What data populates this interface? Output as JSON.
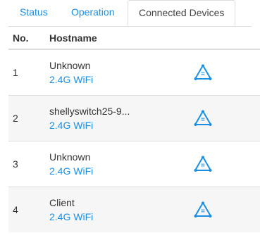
{
  "tabs": [
    {
      "label": "Status"
    },
    {
      "label": "Operation"
    },
    {
      "label": "Connected Devices",
      "active": true
    }
  ],
  "table": {
    "headers": {
      "no": "No.",
      "hostname": "Hostname"
    },
    "rows": [
      {
        "no": "1",
        "hostname": "Unknown",
        "band": "2.4G WiFi",
        "icon": "mesh-topology-icon"
      },
      {
        "no": "2",
        "hostname": "shellyswitch25-9...",
        "band": "2.4G WiFi",
        "icon": "mesh-topology-icon"
      },
      {
        "no": "3",
        "hostname": "Unknown",
        "band": "2.4G WiFi",
        "icon": "mesh-topology-icon"
      },
      {
        "no": "4",
        "hostname": "Client",
        "band": "2.4G WiFi",
        "icon": "mesh-topology-icon"
      }
    ]
  },
  "colors": {
    "accent": "#1a8fe3",
    "row_alt": "#f6f6f6",
    "border": "#dddddd"
  }
}
